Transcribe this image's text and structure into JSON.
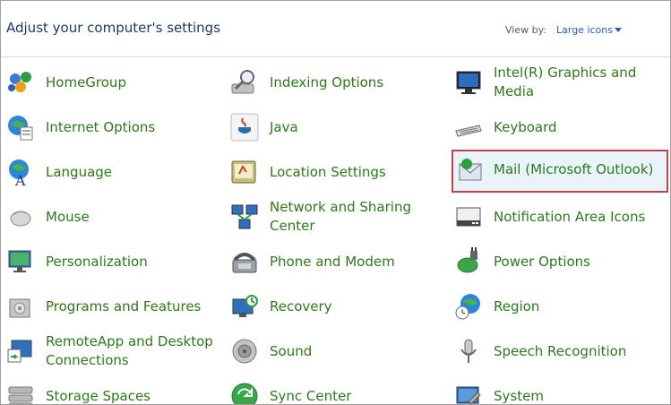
{
  "header": {
    "title": "Adjust your computer's settings",
    "view_by_label": "View by:",
    "view_by_value": "Large icons"
  },
  "items": [
    {
      "label": "HomeGroup",
      "icon": "homegroup-icon"
    },
    {
      "label": "Indexing Options",
      "icon": "indexing-icon"
    },
    {
      "label": "Intel(R) Graphics and Media",
      "icon": "intel-graphics-icon"
    },
    {
      "label": "Internet Options",
      "icon": "internet-options-icon"
    },
    {
      "label": "Java",
      "icon": "java-icon"
    },
    {
      "label": "Keyboard",
      "icon": "keyboard-icon"
    },
    {
      "label": "Language",
      "icon": "language-icon"
    },
    {
      "label": "Location Settings",
      "icon": "location-icon"
    },
    {
      "label": "Mail (Microsoft Outlook)",
      "icon": "mail-icon"
    },
    {
      "label": "Mouse",
      "icon": "mouse-icon"
    },
    {
      "label": "Network and Sharing Center",
      "icon": "network-icon"
    },
    {
      "label": "Notification Area Icons",
      "icon": "notification-icon"
    },
    {
      "label": "Personalization",
      "icon": "personalization-icon"
    },
    {
      "label": "Phone and Modem",
      "icon": "phone-icon"
    },
    {
      "label": "Power Options",
      "icon": "power-icon"
    },
    {
      "label": "Programs and Features",
      "icon": "programs-icon"
    },
    {
      "label": "Recovery",
      "icon": "recovery-icon"
    },
    {
      "label": "Region",
      "icon": "region-icon"
    },
    {
      "label": "RemoteApp and Desktop Connections",
      "icon": "remoteapp-icon"
    },
    {
      "label": "Sound",
      "icon": "sound-icon"
    },
    {
      "label": "Speech Recognition",
      "icon": "speech-icon"
    },
    {
      "label": "Storage Spaces",
      "icon": "storage-icon"
    },
    {
      "label": "Sync Center",
      "icon": "sync-icon"
    },
    {
      "label": "System",
      "icon": "system-icon"
    }
  ],
  "selected_item": "Mail (Microsoft Outlook)",
  "colors": {
    "label": "#2b7a1a",
    "title": "#1e395b",
    "link": "#1e5ec8",
    "selection_border": "#c5404a",
    "selection_fill": "#e8f4fa"
  }
}
